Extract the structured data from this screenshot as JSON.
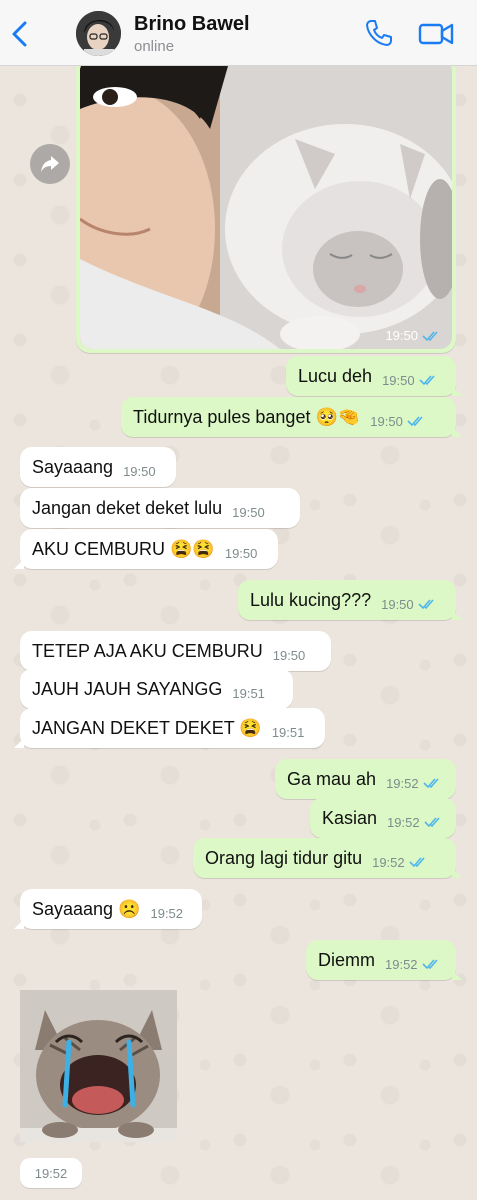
{
  "header": {
    "contact_name": "Brino Bawel",
    "status": "online"
  },
  "colors": {
    "accent": "#1a7cf5",
    "incoming_bubble": "#ffffff",
    "outgoing_bubble": "#dcf8c6",
    "read_ticks": "#4fb6ec",
    "background": "#ece5dd"
  },
  "photo_message": {
    "time": "19:50",
    "status": "read"
  },
  "messages": [
    {
      "dir": "out",
      "text": "Lucu deh",
      "time": "19:50",
      "status": "read"
    },
    {
      "dir": "out",
      "text": "Tidurnya pules banget 🥺🤏",
      "time": "19:50",
      "status": "read"
    },
    {
      "dir": "in",
      "text": "Sayaaang",
      "time": "19:50"
    },
    {
      "dir": "in",
      "text": "Jangan deket deket lulu",
      "time": "19:50"
    },
    {
      "dir": "in",
      "text": "AKU CEMBURU 😫😫",
      "time": "19:50"
    },
    {
      "dir": "out",
      "text": "Lulu kucing???",
      "time": "19:50",
      "status": "read"
    },
    {
      "dir": "in",
      "text": "TETEP AJA AKU CEMBURU",
      "time": "19:50"
    },
    {
      "dir": "in",
      "text": "JAUH JAUH SAYANGG",
      "time": "19:51"
    },
    {
      "dir": "in",
      "text": "JANGAN DEKET DEKET 😫",
      "time": "19:51"
    },
    {
      "dir": "out",
      "text": "Ga mau ah",
      "time": "19:52",
      "status": "read"
    },
    {
      "dir": "out",
      "text": "Kasian",
      "time": "19:52",
      "status": "read"
    },
    {
      "dir": "out",
      "text": "Orang lagi tidur gitu",
      "time": "19:52",
      "status": "read"
    },
    {
      "dir": "in",
      "text": "Sayaaang ☹️",
      "time": "19:52"
    },
    {
      "dir": "out",
      "text": "Diemm",
      "time": "19:52",
      "status": "read"
    }
  ],
  "sticker_message": {
    "time": "19:52"
  }
}
